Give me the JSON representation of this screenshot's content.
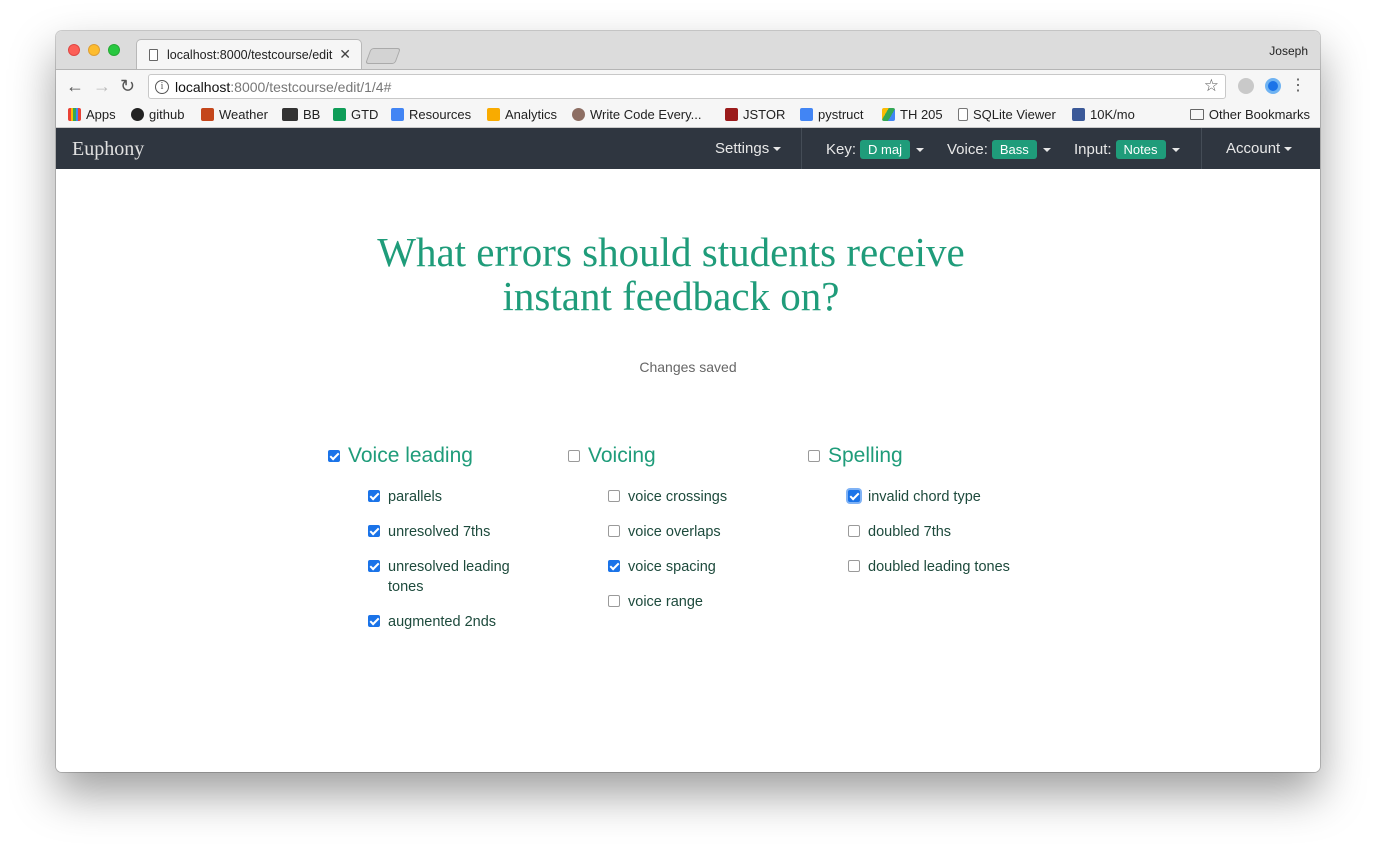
{
  "browser": {
    "tab_title": "localhost:8000/testcourse/edit",
    "tab_close": "✕",
    "profile": "Joseph",
    "url_host": "localhost",
    "url_path": ":8000/testcourse/edit/1/4#",
    "bookmarks": [
      {
        "label": "Apps",
        "icon": "apps-grid-icon",
        "color": "#e94235"
      },
      {
        "label": "github",
        "icon": "github-icon",
        "color": "#222222"
      },
      {
        "label": "Weather",
        "icon": "weather-icon",
        "color": "#c4461b"
      },
      {
        "label": "BB",
        "icon": "blackboard-icon",
        "color": "#333333"
      },
      {
        "label": "GTD",
        "icon": "sheets-icon",
        "color": "#0f9d58"
      },
      {
        "label": "Resources",
        "icon": "docs-icon",
        "color": "#4285f4"
      },
      {
        "label": "Analytics",
        "icon": "analytics-icon",
        "color": "#f9ab00"
      },
      {
        "label": "Write Code Every...",
        "icon": "person-icon",
        "color": "#8d6e63"
      },
      {
        "label": "JSTOR",
        "icon": "jstor-icon",
        "color": "#9b1b1b"
      },
      {
        "label": "pystruct",
        "icon": "docs-icon",
        "color": "#4285f4"
      },
      {
        "label": "TH 205",
        "icon": "drive-icon",
        "color": "#34a853"
      },
      {
        "label": "SQLite Viewer",
        "icon": "page-icon",
        "color": "#ffffff"
      },
      {
        "label": "10K/mo",
        "icon": "chart-icon",
        "color": "#3b5998"
      }
    ],
    "other_bookmarks": "Other Bookmarks"
  },
  "navbar": {
    "brand": "Euphony",
    "settings": "Settings",
    "key_label": "Key:",
    "key_value": "D maj",
    "voice_label": "Voice:",
    "voice_value": "Bass",
    "input_label": "Input:",
    "input_value": "Notes",
    "account": "Account"
  },
  "page": {
    "heading": "What errors should students receive instant feedback on?",
    "status": "Changes saved"
  },
  "groups": [
    {
      "title": "Voice leading",
      "checked": true,
      "options": [
        {
          "label": "parallels",
          "checked": true
        },
        {
          "label": "unresolved 7ths",
          "checked": true
        },
        {
          "label": "unresolved leading tones",
          "checked": true
        },
        {
          "label": "augmented 2nds",
          "checked": true
        }
      ]
    },
    {
      "title": "Voicing",
      "checked": false,
      "options": [
        {
          "label": "voice crossings",
          "checked": false
        },
        {
          "label": "voice overlaps",
          "checked": false
        },
        {
          "label": "voice spacing",
          "checked": true
        },
        {
          "label": "voice range",
          "checked": false
        }
      ]
    },
    {
      "title": "Spelling",
      "checked": false,
      "options": [
        {
          "label": "invalid chord type",
          "checked": true,
          "focused": true
        },
        {
          "label": "doubled 7ths",
          "checked": false
        },
        {
          "label": "doubled leading tones",
          "checked": false
        }
      ]
    }
  ],
  "colors": {
    "accent": "#1f9c7a",
    "navbar_bg": "#2f3640",
    "checkbox_on": "#1a73e8"
  }
}
